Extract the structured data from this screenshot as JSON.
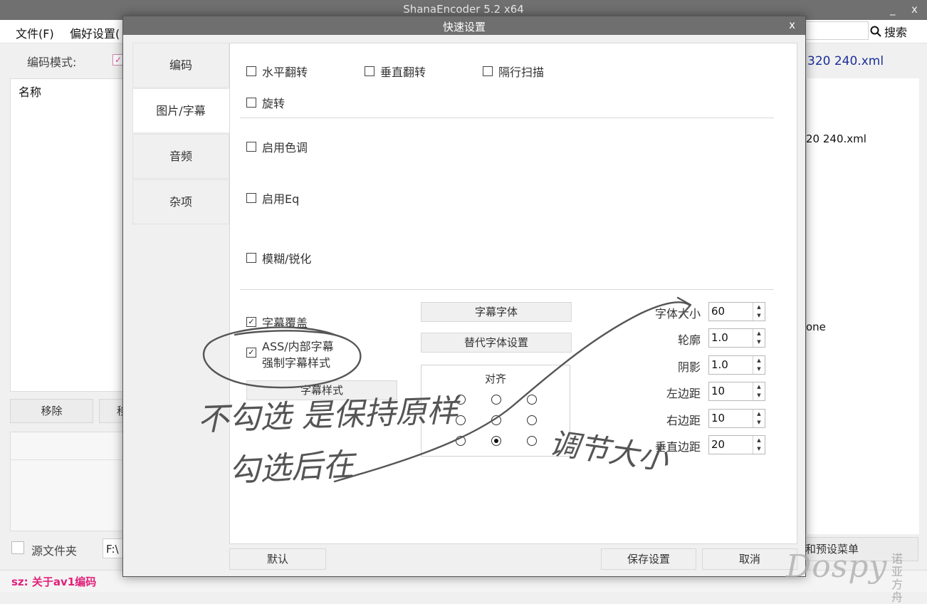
{
  "main_window": {
    "title": "ShanaEncoder 5.2 x64",
    "minimize": "_",
    "close": "x",
    "menu": [
      "文件(F)",
      "偏好设置("
    ],
    "search_label": "搜索",
    "encode_mode_label": "编码模式:",
    "list_header": "名称",
    "remove_button": "移除",
    "second_button": "移",
    "source_folder_label": "源文件夹",
    "path_value": "F:\\",
    "status_text": "sz: 关于av1编码",
    "right_xml_top": "320 240.xml",
    "right_xml_2": "20 240.xml",
    "right_none": "one",
    "right_preset_button": "和预设菜单"
  },
  "dialog": {
    "title": "快速设置",
    "close": "x",
    "tabs": [
      "编码",
      "图片/字幕",
      "音频",
      "杂项"
    ],
    "active_tab": 1,
    "checkboxes": {
      "hflip": "水平翻转",
      "vflip": "垂直翻转",
      "interlace": "隔行扫描",
      "rotate": "旋转",
      "hue": "启用色调",
      "eq": "启用Eq",
      "blur": "模糊/锐化",
      "sub_overlay": "字幕覆盖",
      "ass_line1": "ASS/内部字幕",
      "ass_line2": "强制字幕样式"
    },
    "checked": {
      "sub_overlay": true,
      "ass_force": true
    },
    "subtitle_style_button": "字幕样式",
    "subtitle_font_button": "字幕字体",
    "alt_font_button": "替代字体设置",
    "align_title": "对齐",
    "align_selected": "bottom-center",
    "spinners": [
      {
        "label": "字体大小",
        "value": "60"
      },
      {
        "label": "轮廓",
        "value": "1.0"
      },
      {
        "label": "阴影",
        "value": "1.0"
      },
      {
        "label": "左边距",
        "value": "10"
      },
      {
        "label": "右边距",
        "value": "10"
      },
      {
        "label": "垂直边距",
        "value": "20"
      }
    ],
    "default_button": "默认",
    "save_button": "保存设置",
    "cancel_button": "取消"
  },
  "annotation": {
    "line1": "不勾选 是保持原样",
    "line2": "勾选后在",
    "line3": "调节大小",
    "ink_color": "#555555"
  },
  "watermark": {
    "text": "Dospy",
    "cn": "诺亚方舟"
  }
}
